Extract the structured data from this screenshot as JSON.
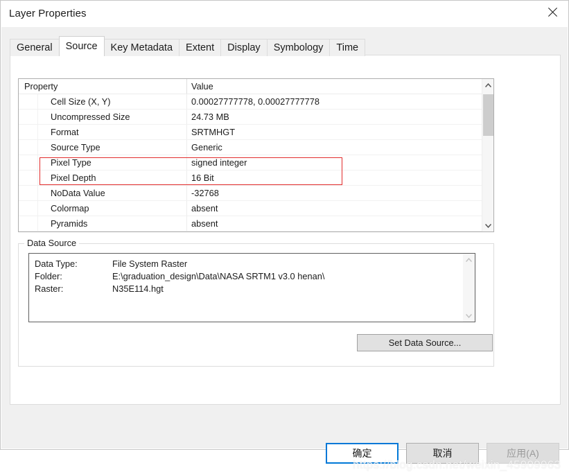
{
  "window": {
    "title": "Layer Properties",
    "close_icon": "close-icon"
  },
  "tabs": [
    {
      "label": "General",
      "active": false
    },
    {
      "label": "Source",
      "active": true
    },
    {
      "label": "Key Metadata",
      "active": false
    },
    {
      "label": "Extent",
      "active": false
    },
    {
      "label": "Display",
      "active": false
    },
    {
      "label": "Symbology",
      "active": false
    },
    {
      "label": "Time",
      "active": false
    }
  ],
  "property_grid": {
    "headers": {
      "property": "Property",
      "value": "Value"
    },
    "rows": [
      {
        "property": "Cell Size (X, Y)",
        "value": "0.00027777778, 0.00027777778",
        "highlighted": false
      },
      {
        "property": "Uncompressed Size",
        "value": "24.73 MB",
        "highlighted": false
      },
      {
        "property": "Format",
        "value": "SRTMHGT",
        "highlighted": false
      },
      {
        "property": "Source Type",
        "value": "Generic",
        "highlighted": false
      },
      {
        "property": "Pixel Type",
        "value": "signed integer",
        "highlighted": true
      },
      {
        "property": "Pixel Depth",
        "value": "16 Bit",
        "highlighted": true
      },
      {
        "property": "NoData Value",
        "value": "-32768",
        "highlighted": false
      },
      {
        "property": "Colormap",
        "value": "absent",
        "highlighted": false
      },
      {
        "property": "Pyramids",
        "value": "absent",
        "highlighted": false
      }
    ],
    "scrollbar": {
      "up_icon": "chevron-up-icon",
      "down_icon": "chevron-down-icon"
    },
    "highlight_color": "#e22b2b"
  },
  "data_source": {
    "legend": "Data Source",
    "rows": [
      {
        "label": "Data Type:",
        "value": "File System Raster"
      },
      {
        "label": "Folder:",
        "value": "E:\\graduation_design\\Data\\NASA SRTM1 v3.0 henan\\"
      },
      {
        "label": "Raster:",
        "value": "N35E114.hgt"
      }
    ],
    "scrollbar": {
      "up_icon": "chevron-up-icon",
      "down_icon": "chevron-down-icon"
    },
    "set_data_source_label": "Set Data Source..."
  },
  "footer": {
    "ok_label": "确定",
    "cancel_label": "取消",
    "apply_label": "应用(A)",
    "accent_color": "#0078d7"
  },
  "watermark": "https://blog.csdn.net/weixin_45909963"
}
